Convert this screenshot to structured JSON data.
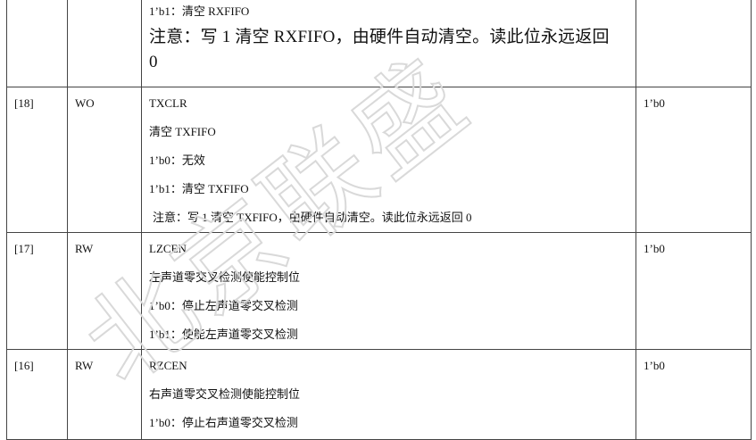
{
  "watermark": {
    "text": "北京联盛",
    "color": "#d9d9d9"
  },
  "rows": [
    {
      "bit": "",
      "access": "",
      "desc_small": [
        "1’b1：清空 RXFIFO"
      ],
      "desc_note_line1": "注意：写 1 清空 RXFIFO，由硬件自动清空。读此位永远返回",
      "desc_note_line2": "0",
      "reset": ""
    },
    {
      "bit": "[18]",
      "access": "WO",
      "desc": [
        "TXCLR",
        "清空 TXFIFO",
        "1’b0：无效",
        "1’b1：清空 TXFIFO"
      ],
      "note": "注意：写 1 清空 TXFIFO，由硬件自动清空。读此位永远返回 0",
      "reset": "1’b0"
    },
    {
      "bit": "[17]",
      "access": "RW",
      "desc": [
        "LZCEN",
        "左声道零交叉检测使能控制位",
        "1’b0：停止左声道零交叉检测",
        "1’b1：使能左声道零交叉检测"
      ],
      "reset": "1’b0"
    },
    {
      "bit": "[16]",
      "access": "RW",
      "desc": [
        "RZCEN",
        "右声道零交叉检测使能控制位",
        "1’b0：停止右声道零交叉检测"
      ],
      "reset": "1’b0"
    }
  ]
}
